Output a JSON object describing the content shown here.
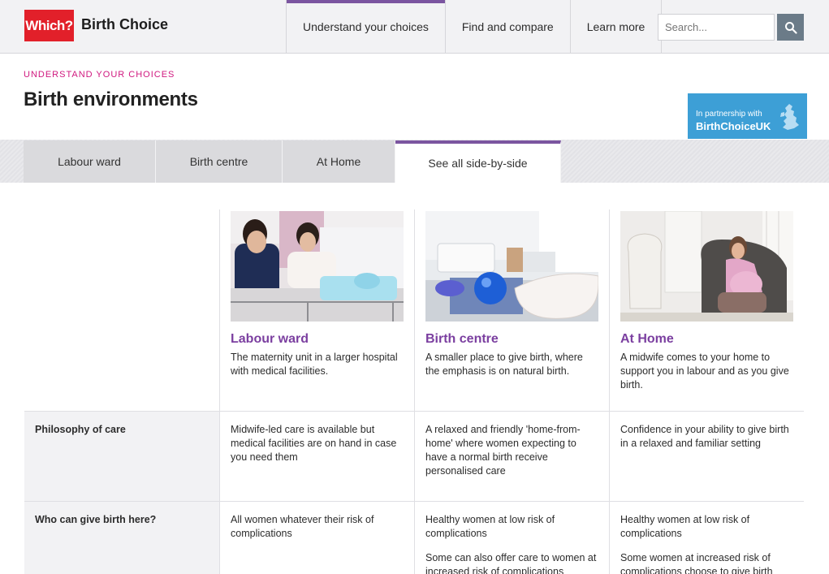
{
  "header": {
    "logo_text": "Which?",
    "brand": "Birth Choice",
    "nav": [
      {
        "label": "Understand your choices",
        "active": true
      },
      {
        "label": "Find and compare",
        "active": false
      },
      {
        "label": "Learn more",
        "active": false
      }
    ],
    "search_placeholder": "Search...",
    "search_icon": "search-icon"
  },
  "page": {
    "eyebrow": "UNDERSTAND YOUR CHOICES",
    "title": "Birth environments",
    "partner_small": "In partnership with",
    "partner_big": "BirthChoiceUK"
  },
  "tabs": [
    {
      "label": "Labour ward",
      "active": false
    },
    {
      "label": "Birth centre",
      "active": false
    },
    {
      "label": "At Home",
      "active": false
    },
    {
      "label": "See all side-by-side",
      "active": true
    }
  ],
  "environments": [
    {
      "title": "Labour ward",
      "desc": "The maternity unit in a larger hospital with medical facilities."
    },
    {
      "title": "Birth centre",
      "desc": "A smaller place to give birth, where the emphasis is on natural birth."
    },
    {
      "title": "At Home",
      "desc": "A midwife comes to your home to support you in labour and as you give birth."
    }
  ],
  "rows": {
    "philosophy": {
      "label": "Philosophy of care",
      "values": [
        "Midwife-led care is available but medical facilities are on hand in case you need them",
        "A relaxed and friendly 'home-from-home' where women expecting to have a normal birth receive personalised care",
        "Confidence in your ability to give birth in a relaxed and familiar setting"
      ]
    },
    "who": {
      "label": "Who can give birth here?",
      "values": [
        "All women whatever their risk of complications",
        "Healthy women at low risk of complications",
        "Healthy women at low risk of complications"
      ],
      "extra": [
        "",
        "Some can also offer care to women at increased risk of complications",
        "Some women at increased risk of complications choose to give birth"
      ]
    }
  },
  "colors": {
    "accent_purple": "#7b55a0",
    "title_purple": "#7b3fa0",
    "eyebrow_pink": "#d0187f",
    "which_red": "#e2202a",
    "partner_blue": "#3d9fd6"
  }
}
